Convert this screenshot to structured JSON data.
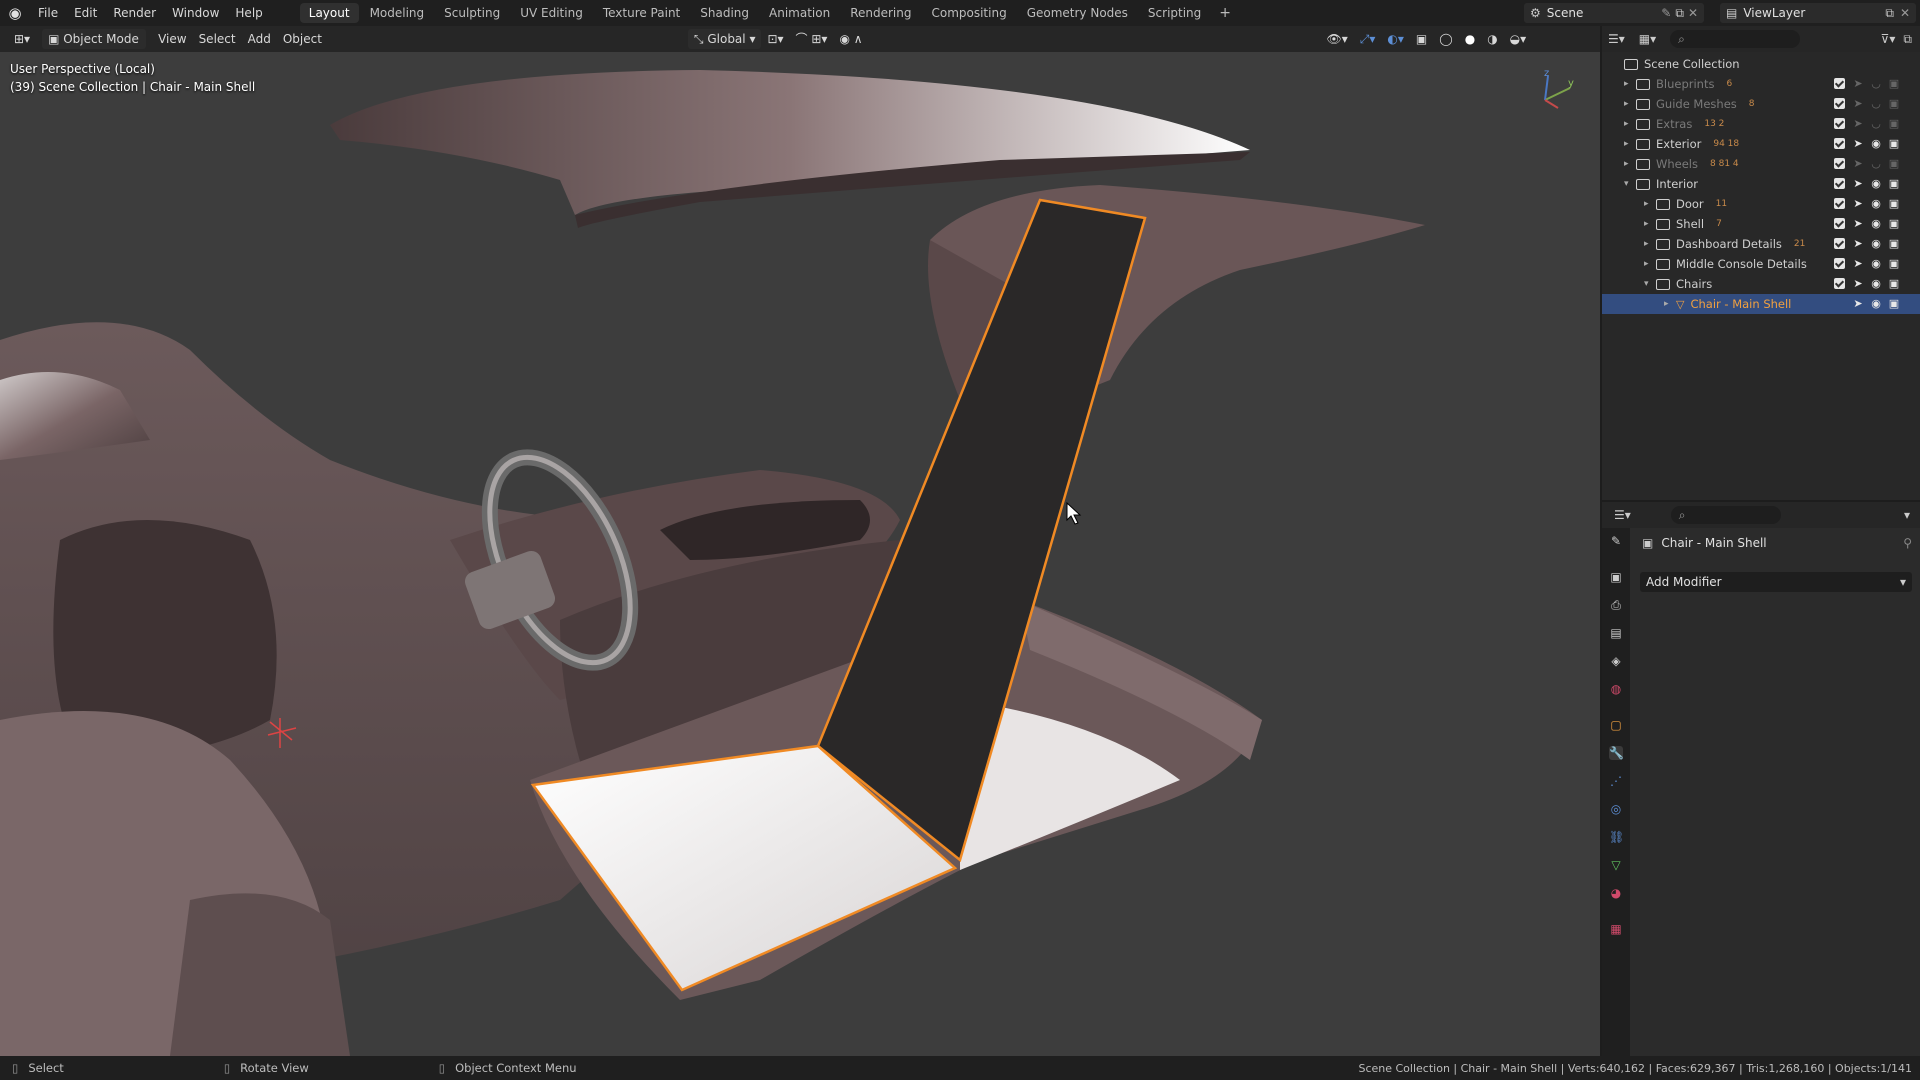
{
  "menu": [
    "File",
    "Edit",
    "Render",
    "Window",
    "Help"
  ],
  "workspaces": [
    "Layout",
    "Modeling",
    "Sculpting",
    "UV Editing",
    "Texture Paint",
    "Shading",
    "Animation",
    "Rendering",
    "Compositing",
    "Geometry Nodes",
    "Scripting"
  ],
  "active_workspace": "Layout",
  "scene_name": "Scene",
  "view_layer": "ViewLayer",
  "header": {
    "mode": "Object Mode",
    "view": "View",
    "select": "Select",
    "add": "Add",
    "object": "Object",
    "transform": "Global"
  },
  "viewport": {
    "perspective": "User Perspective (Local)",
    "context": "(39) Scene Collection | Chair - Main Shell"
  },
  "outliner": {
    "root": "Scene Collection",
    "rows": [
      {
        "label": "Blueprints",
        "badge": "6",
        "dim": true
      },
      {
        "label": "Guide Meshes",
        "badge": "8",
        "dim": true
      },
      {
        "label": "Extras",
        "badge": "13  2",
        "dim": true
      },
      {
        "label": "Exterior",
        "badge": "94  18",
        "dim": false
      },
      {
        "label": "Wheels",
        "badge": "8  81  4",
        "dim": true
      },
      {
        "label": "Interior",
        "badge": "",
        "dim": false
      },
      {
        "label": "Door",
        "badge": "11",
        "dim": false
      },
      {
        "label": "Shell",
        "badge": "7",
        "dim": false
      },
      {
        "label": "Dashboard Details",
        "badge": "21",
        "dim": false
      },
      {
        "label": "Middle Console Details",
        "badge": "",
        "dim": false
      },
      {
        "label": "Chairs",
        "badge": "",
        "dim": false
      },
      {
        "label": "Chair - Main Shell",
        "badge": "",
        "dim": false
      }
    ]
  },
  "properties": {
    "object_name": "Chair - Main Shell",
    "add_modifier": "Add Modifier"
  },
  "status": {
    "select": "Select",
    "rotate": "Rotate View",
    "context_menu": "Object Context Menu",
    "stats": "Scene Collection | Chair - Main Shell | Verts:640,162 | Faces:629,367 | Tris:1,268,160 | Objects:1/141"
  },
  "colors": {
    "accent": "#4772b3",
    "selection_outline": "#f08a24",
    "viewport_bg": "#3d3d3d",
    "mesh_color": "#6e5a5c"
  }
}
